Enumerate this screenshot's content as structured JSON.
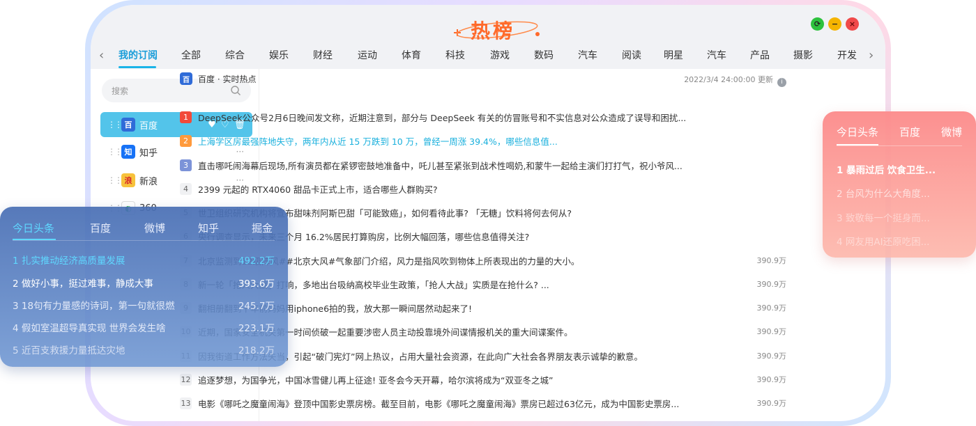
{
  "app": {
    "title": "热榜",
    "controls": [
      "refresh",
      "minimize",
      "close"
    ]
  },
  "tabs": [
    "我的订阅",
    "全部",
    "综合",
    "娱乐",
    "财经",
    "运动",
    "体育",
    "科技",
    "游戏",
    "数码",
    "汽车",
    "阅读",
    "明星",
    "汽车",
    "产品",
    "摄影",
    "开发"
  ],
  "sidebar": {
    "search_placeholder": "搜索",
    "items": [
      {
        "label": "百度",
        "logo": "百",
        "color": "#2f6bd8",
        "active": true
      },
      {
        "label": "知乎",
        "logo": "知",
        "color": "#1772f6",
        "active": false
      },
      {
        "label": "新浪",
        "logo": "浪",
        "color": "#f7c23c",
        "active": false
      },
      {
        "label": "360",
        "logo": "◐",
        "color": "#ffffff",
        "active": false
      }
    ],
    "more": "···"
  },
  "main": {
    "source": "百度 · 实时热点",
    "updated": "2022/3/4  24:00:00 更新",
    "rows": [
      {
        "rank": "1",
        "text": "DeepSeek公众号2月6日晚间发文称，近期注意到，部分与 DeepSeek 有关的仿冒账号和不实信息对公众造成了误导和困扰...",
        "hot": ""
      },
      {
        "rank": "2",
        "text": "上海学区房最强阵地失守，两年内从近 15 万跌到 10 万，曾经一周涨 39.4%，哪些信息值...",
        "hot": ""
      },
      {
        "rank": "3",
        "text": "直击哪吒闹海幕后现场,所有演员都在紧锣密鼓地准备中，吒儿甚至紧张到战术性喝奶,和蒙牛一起给主演们打打气，祝小爷风...",
        "hot": ""
      },
      {
        "rank": "4",
        "text": "2399 元起的 RTX4060 甜品卡正式上市，适合哪些人群购买?",
        "hot": ""
      },
      {
        "rank": "5",
        "text": "世卫组织研究机构将宣布甜味剂阿斯巴甜「可能致癌」，如何看待此事? 「无糖」饮料将何去何从?",
        "hot": ""
      },
      {
        "rank": "6",
        "text": "央行调查显示，未来三个月 16.2%居民打算购房，比例大幅回落，哪些信息值得关注?",
        "hot": ""
      },
      {
        "rank": "7",
        "text": "北京监测到12级阵风##北京大风#气象部门介绍，风力是指风吹到物体上所表现出的力量的大小。",
        "hot": "390.9万"
      },
      {
        "rank": "8",
        "text": "新一轮「抢人大战」打响，多地出台吸纳高校毕业生政策，「抢人大战」实质是在抢什么? ...",
        "hot": "390.9万"
      },
      {
        "rank": "9",
        "text": "翻相册翻到十年前妈妈用iphone6拍的我，放大那一瞬间居然动起来了!",
        "hot": "390.9万"
      },
      {
        "rank": "10",
        "text": "近期，国家安全机关第一时间侦破一起重要涉密人员主动投靠境外间谍情报机关的重大间谍案件。",
        "hot": "390.9万"
      },
      {
        "rank": "11",
        "text": "因我街道工作方法失当，引起“破门宪灯”网上热议，占用大量社会资源，在此向广大社会各界朋友表示诚挚的歉意。",
        "hot": "390.9万"
      },
      {
        "rank": "12",
        "text": "追逐梦想，为国争光，中国冰雪健儿再上征途! 亚冬会今天开幕，哈尔滨将成为“双亚冬之城”",
        "hot": "390.9万"
      },
      {
        "rank": "13",
        "text": "电影《哪吒之魔童闹海》登顶中国影史票房榜。截至目前，电影《哪吒之魔童闹海》票房已超过63亿元，成为中国影史票房...",
        "hot": "390.9万"
      }
    ]
  },
  "card_left": {
    "tabs": [
      "今日头条",
      "百度",
      "微博",
      "知乎",
      "掘金"
    ],
    "rows": [
      {
        "text": "1  扎实推动经济高质量发展",
        "value": "492.2万"
      },
      {
        "text": "2  做好小事，挺过难事，静成大事",
        "value": "393.6万"
      },
      {
        "text": "3  18句有力量感的诗词，第一句就很燃",
        "value": "245.7万"
      },
      {
        "text": "4  假如室温超导真实现 世界会发生啥",
        "value": "223.1万"
      },
      {
        "text": "5  近百支救援力量抵达灾地",
        "value": "218.2万"
      }
    ]
  },
  "card_right": {
    "tabs": [
      "今日头条",
      "百度",
      "微博"
    ],
    "rows": [
      "1  暴雨过后 饮食卫生...",
      "2  台风为什么大角度...",
      "3  致敬每一个挺身而...",
      "4  网友用AI还原吃困..."
    ]
  }
}
